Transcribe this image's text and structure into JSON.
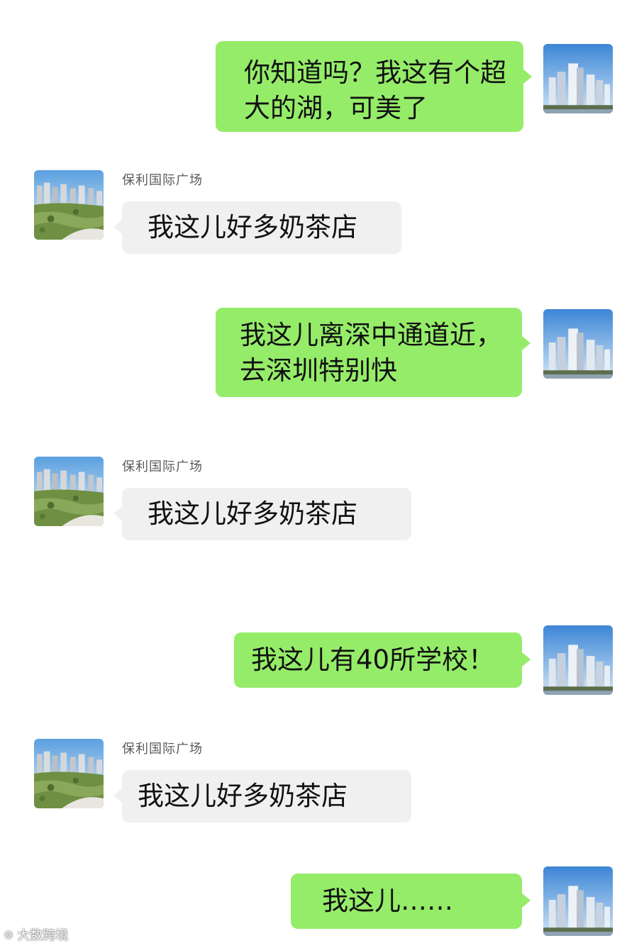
{
  "contact_name": "保利国际广场",
  "messages": [
    {
      "side": "right",
      "text": "你知道吗？我这有个超大的湖，可美了"
    },
    {
      "side": "left",
      "text": "我这儿好多奶茶店"
    },
    {
      "side": "right",
      "text": "我这儿离深中通道近，去深圳特别快"
    },
    {
      "side": "left",
      "text": "我这儿好多奶茶店"
    },
    {
      "side": "right",
      "text": "我这儿有40所学校！"
    },
    {
      "side": "left",
      "text": "我这儿好多奶茶店"
    },
    {
      "side": "right",
      "text": "我这儿……"
    }
  ],
  "watermark": "大数跨境",
  "colors": {
    "right_bubble": "#95ec69",
    "left_bubble": "#f0f0f0",
    "background": "#ffffff"
  },
  "icons": {
    "right_avatar": "city-skyline-avatar",
    "left_avatar": "lakeside-community-avatar"
  }
}
